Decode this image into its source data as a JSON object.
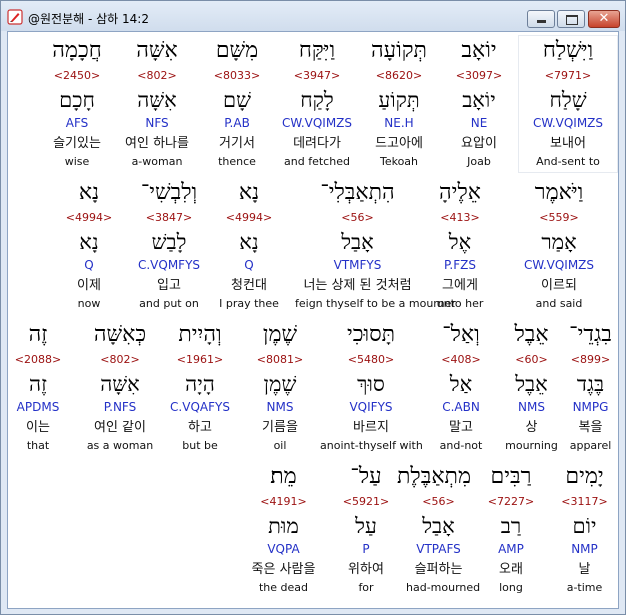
{
  "window": {
    "title": "@원전분해 - 삼하 14:2",
    "icon": "pen-icon",
    "min_icon": "minimize-icon",
    "max_icon": "maximize-icon",
    "close_label": "✕"
  },
  "rows": [
    {
      "words": [
        {
          "heb": "חֲכָמָה",
          "num": "<2450>",
          "lex": "חָכָם",
          "morph": "AFS",
          "kor": "슬기있는",
          "eng": "wise"
        },
        {
          "heb": "אִשָּׁה",
          "num": "<802>",
          "lex": "אִשָּׁה",
          "morph": "NFS",
          "kor": "여인 하나를",
          "eng": "a-woman"
        },
        {
          "heb": "מִשָּׁם",
          "num": "<8033>",
          "lex": "שָׁם",
          "morph": "P.AB",
          "kor": "거기서",
          "eng": "thence"
        },
        {
          "heb": "וַיִּקַּח",
          "num": "<3947>",
          "lex": "לָקַח",
          "morph": "CW.VQIMZS",
          "kor": "데려다가",
          "eng": "and fetched"
        },
        {
          "heb": "תְּקוֹעָה",
          "num": "<8620>",
          "lex": "תְּקוֹעַ",
          "morph": "NE.H",
          "kor": "드고아에",
          "eng": "Tekoah"
        },
        {
          "heb": "יוֹאָב",
          "num": "<3097>",
          "lex": "יוֹאָב",
          "morph": "NE",
          "kor": "요압이",
          "eng": "Joab"
        },
        {
          "heb": "וַיִּשְׁלַח",
          "num": "<7971>",
          "lex": "שָׁלַח",
          "morph": "CW.VQIMZS",
          "kor": "보내어",
          "eng": "And-sent to",
          "selected": true
        }
      ]
    },
    {
      "words": [
        {
          "heb": "נָא",
          "num": "<4994>",
          "lex": "נָא",
          "morph": "Q",
          "kor": "이제",
          "eng": "now"
        },
        {
          "heb": "וְלִבְשִׁי־",
          "num": "<3847>",
          "lex": "לָבַשׁ",
          "morph": "C.VQMFYS",
          "kor": "입고",
          "eng": "and put on"
        },
        {
          "heb": "נָא",
          "num": "<4994>",
          "lex": "נָא",
          "morph": "Q",
          "kor": "청컨대",
          "eng": "I pray thee"
        },
        {
          "heb": "הִתְאַבְּלִי־",
          "num": "<56>",
          "lex": "אָבַל",
          "morph": "VTMFYS",
          "kor": "너는 상제 된 것처럼",
          "eng": "feign thyself to be a mourner"
        },
        {
          "heb": "אֵלֶיהָ",
          "num": "<413>",
          "lex": "אֶל",
          "morph": "P.FZS",
          "kor": "그에게",
          "eng": "unto her"
        },
        {
          "heb": "וַיֹּאמֶר",
          "num": "<559>",
          "lex": "אָמַר",
          "morph": "CW.VQIMZS",
          "kor": "이르되",
          "eng": "and said"
        }
      ]
    },
    {
      "words": [
        {
          "heb": "זֶה",
          "num": "<2088>",
          "lex": "זֶה",
          "morph": "APDMS",
          "kor": "이는",
          "eng": "that"
        },
        {
          "heb": "כְּאִשָּׁה",
          "num": "<802>",
          "lex": "אִשָּׁה",
          "morph": "P.NFS",
          "kor": "여인 같이",
          "eng": "as a woman"
        },
        {
          "heb": "וְהָיִית",
          "num": "<1961>",
          "lex": "הָיָה",
          "morph": "C.VQAFYS",
          "kor": "하고",
          "eng": "but be"
        },
        {
          "heb": "שֶׁמֶן",
          "num": "<8081>",
          "lex": "שֶׁמֶן",
          "morph": "NMS",
          "kor": "기름을",
          "eng": "oil"
        },
        {
          "heb": "תָּסוּכִי",
          "num": "<5480>",
          "lex": "סוּךְ",
          "morph": "VQIFYS",
          "kor": "바르지",
          "eng": "anoint-thyself with"
        },
        {
          "heb": "וְאַל־",
          "num": "<408>",
          "lex": "אַל",
          "morph": "C.ABN",
          "kor": "말고",
          "eng": "and-not"
        },
        {
          "heb": "אֵבֶל",
          "num": "<60>",
          "lex": "אֵבֶל",
          "morph": "NMS",
          "kor": "상",
          "eng": "mourning"
        },
        {
          "heb": "בִגְדֵי־",
          "num": "<899>",
          "lex": "בֶּגֶד",
          "morph": "NMPG",
          "kor": "복을",
          "eng": "apparel"
        }
      ]
    },
    {
      "words": [
        {
          "heb": "מֵת׃",
          "num": "<4191>",
          "lex": "מוּת",
          "morph": "VQPA",
          "kor": "죽은 사람을",
          "eng": "the dead"
        },
        {
          "heb": "עַל־",
          "num": "<5921>",
          "lex": "עַל",
          "morph": "P",
          "kor": "위하여",
          "eng": "for"
        },
        {
          "heb": "מִתְאַבֶּלֶת",
          "num": "<56>",
          "lex": "אָבַל",
          "morph": "VTPAFS",
          "kor": "슬퍼하는",
          "eng": "had-mourned"
        },
        {
          "heb": "רַבִּים",
          "num": "<7227>",
          "lex": "רַב",
          "morph": "AMP",
          "kor": "오래",
          "eng": "long"
        },
        {
          "heb": "יָמִים",
          "num": "<3117>",
          "lex": "יוֹם",
          "morph": "NMP",
          "kor": "날",
          "eng": "a-time"
        }
      ]
    }
  ]
}
